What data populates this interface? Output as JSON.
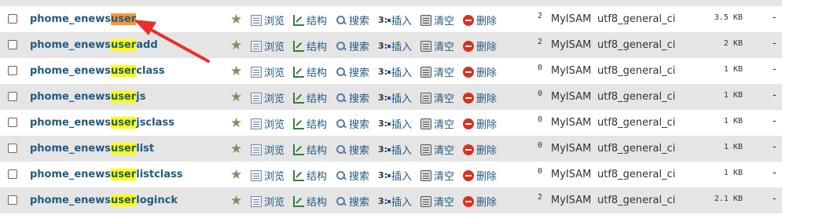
{
  "search_term": "user",
  "actions": {
    "browse": "浏览",
    "structure": "结构",
    "search": "搜索",
    "insert": "插入",
    "empty": "清空",
    "drop": "删除"
  },
  "tables": [
    {
      "prefix": "phome_enews",
      "match": "user",
      "suffix": "",
      "rows": "2",
      "engine": "MyISAM",
      "collation": "utf8_general_ci",
      "size": "3.5 KB",
      "overhead": "-"
    },
    {
      "prefix": "phome_enews",
      "match": "user",
      "suffix": "add",
      "rows": "2",
      "engine": "MyISAM",
      "collation": "utf8_general_ci",
      "size": "2 KB",
      "overhead": "-"
    },
    {
      "prefix": "phome_enews",
      "match": "user",
      "suffix": "class",
      "rows": "0",
      "engine": "MyISAM",
      "collation": "utf8_general_ci",
      "size": "1 KB",
      "overhead": "-"
    },
    {
      "prefix": "phome_enews",
      "match": "user",
      "suffix": "js",
      "rows": "0",
      "engine": "MyISAM",
      "collation": "utf8_general_ci",
      "size": "1 KB",
      "overhead": "-"
    },
    {
      "prefix": "phome_enews",
      "match": "user",
      "suffix": "jsclass",
      "rows": "0",
      "engine": "MyISAM",
      "collation": "utf8_general_ci",
      "size": "1 KB",
      "overhead": "-"
    },
    {
      "prefix": "phome_enews",
      "match": "user",
      "suffix": "list",
      "rows": "0",
      "engine": "MyISAM",
      "collation": "utf8_general_ci",
      "size": "1 KB",
      "overhead": "-"
    },
    {
      "prefix": "phome_enews",
      "match": "user",
      "suffix": "listclass",
      "rows": "0",
      "engine": "MyISAM",
      "collation": "utf8_general_ci",
      "size": "1 KB",
      "overhead": "-"
    },
    {
      "prefix": "phome_enews",
      "match": "user",
      "suffix": "loginck",
      "rows": "2",
      "engine": "MyISAM",
      "collation": "utf8_general_ci",
      "size": "2.1 KB",
      "overhead": "-"
    }
  ],
  "colors": {
    "link": "#235a81",
    "highlight": "#ffff00",
    "current_highlight": "#ff9632",
    "annotation_arrow": "#e8302a"
  }
}
